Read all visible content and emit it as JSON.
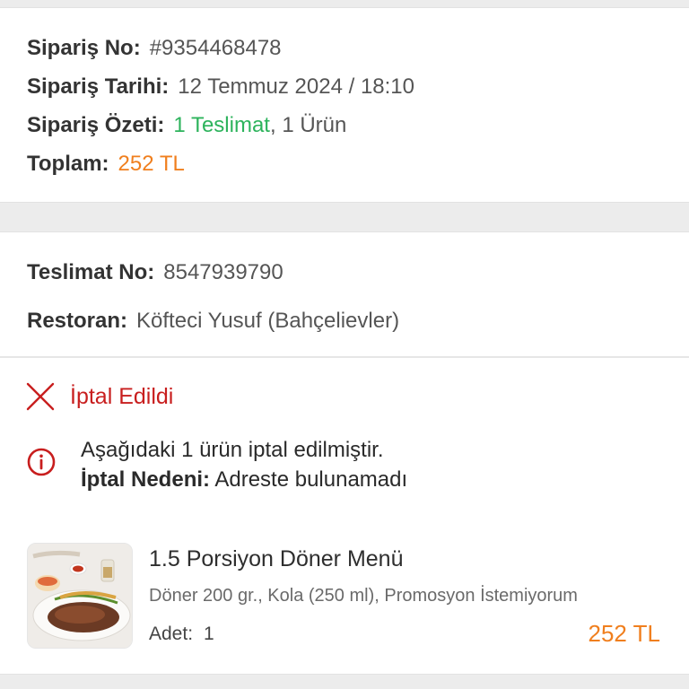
{
  "order": {
    "order_no_label": "Sipariş No:",
    "order_no_value": "#9354468478",
    "order_date_label": "Sipariş Tarihi:",
    "order_date_value": "12 Temmuz 2024 / 18:10",
    "summary_label": "Sipariş Özeti:",
    "summary_delivery": "1 Teslimat",
    "summary_sep": ",",
    "summary_items": " 1 Ürün",
    "total_label": "Toplam:",
    "total_value": "252 TL"
  },
  "delivery": {
    "delivery_no_label": "Teslimat No:",
    "delivery_no_value": "8547939790",
    "restaurant_label": "Restoran:",
    "restaurant_value": "Köfteci Yusuf (Bahçelievler)",
    "status": "İptal Edildi",
    "status_icon": "close-icon",
    "info_icon": "info-icon",
    "info_line1": "Aşağıdaki 1 ürün iptal edilmiştir.",
    "reason_label": "İptal Nedeni:",
    "reason_value": "Adreste bulunamadı"
  },
  "product": {
    "title": "1.5 Porsiyon Döner Menü",
    "description": "Döner 200 gr., Kola (250 ml), Promosyon İstemiyorum",
    "qty_label": "Adet:",
    "qty_value": "1",
    "price": "252 TL"
  },
  "colors": {
    "green": "#2db35c",
    "orange": "#f07f1e",
    "red": "#c81e1e"
  }
}
